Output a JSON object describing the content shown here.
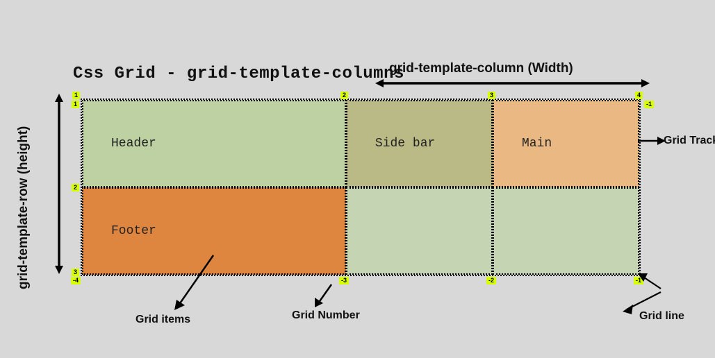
{
  "title": "Css Grid - grid-template-columns",
  "labels": {
    "width": "grid-template-column (Width)",
    "height": "grid-template-row (height)"
  },
  "cells": {
    "header": "Header",
    "sidebar": "Side bar",
    "main": "Main",
    "footer": "Footer"
  },
  "line_numbers": {
    "top": [
      "1",
      "2",
      "3",
      "4"
    ],
    "bottom": [
      "-4",
      "-3",
      "-2",
      "-1"
    ],
    "left": [
      "1",
      "2",
      "3"
    ],
    "right": [
      "-1"
    ]
  },
  "callouts": {
    "grid_track": "Grid Track",
    "grid_items": "Grid items",
    "grid_number": "Grid Number",
    "grid_line": "Grid line"
  }
}
